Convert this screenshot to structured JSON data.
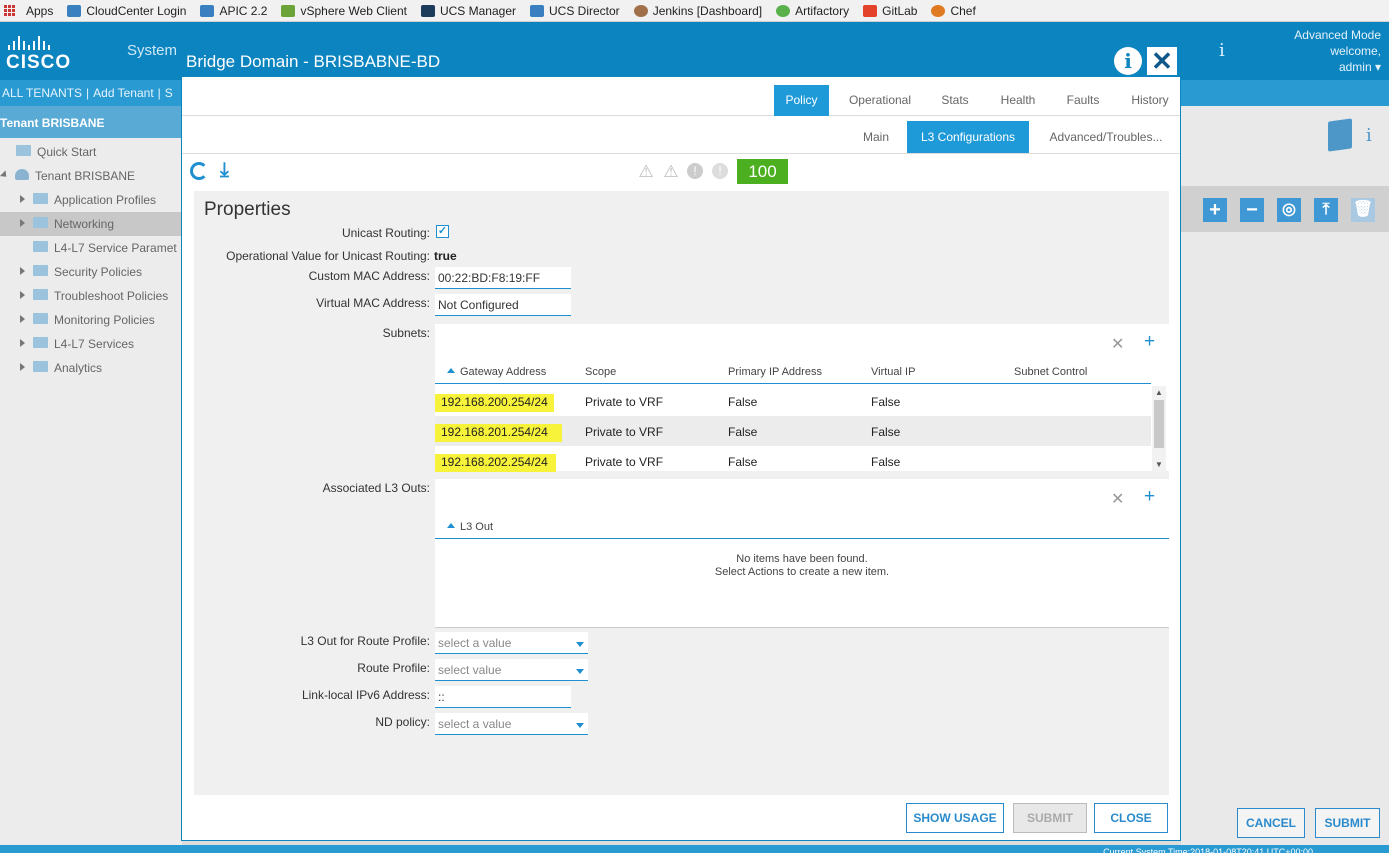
{
  "bookmarks": [
    {
      "label": "Apps",
      "color": "#cc3333"
    },
    {
      "label": "CloudCenter Login",
      "color": "#3a7fc0"
    },
    {
      "label": "APIC 2.2",
      "color": "#3a7fc0"
    },
    {
      "label": "vSphere Web Client",
      "color": "#6ca33a"
    },
    {
      "label": "UCS Manager",
      "color": "#1d3c5c"
    },
    {
      "label": "UCS Director",
      "color": "#3a7fc0"
    },
    {
      "label": "Jenkins [Dashboard]",
      "color": "#a0704a"
    },
    {
      "label": "Artifactory",
      "color": "#5ab04a"
    },
    {
      "label": "GitLab",
      "color": "#e2432a"
    },
    {
      "label": "Chef",
      "color": "#e07a22"
    }
  ],
  "header": {
    "logo_text": "CISCO",
    "nav_system": "System",
    "mode": "Advanced Mode",
    "welcome": "welcome,",
    "user": "admin ▾",
    "info_glyph": "i"
  },
  "subnav": {
    "all_tenants": "ALL TENANTS",
    "sep": "|",
    "add_tenant": "Add Tenant",
    "sep2": "|",
    "more": "S"
  },
  "sidebar": {
    "tenant_head": "Tenant BRISBANE",
    "items": [
      {
        "label": "Quick Start"
      },
      {
        "label": "Tenant BRISBANE"
      },
      {
        "label": "Application Profiles"
      },
      {
        "label": "Networking"
      },
      {
        "label": "L4-L7 Service Paramet"
      },
      {
        "label": "Security Policies"
      },
      {
        "label": "Troubleshoot Policies"
      },
      {
        "label": "Monitoring Policies"
      },
      {
        "label": "L4-L7 Services"
      },
      {
        "label": "Analytics"
      }
    ]
  },
  "background": {
    "cancel": "CANCEL",
    "submit": "SUBMIT",
    "status": "Current System Time:2018-01-08T20:41 UTC+00:00",
    "info_glyph": "i"
  },
  "modal": {
    "title": "Bridge Domain - BRISBABNE-BD",
    "info_glyph": "i",
    "close_glyph": "✕",
    "tabs": [
      {
        "label": "Policy"
      },
      {
        "label": "Operational"
      },
      {
        "label": "Stats"
      },
      {
        "label": "Health"
      },
      {
        "label": "Faults"
      },
      {
        "label": "History"
      }
    ],
    "subtabs": [
      {
        "label": "Main"
      },
      {
        "label": "L3 Configurations"
      },
      {
        "label": "Advanced/Troubles..."
      }
    ],
    "health_score": "100",
    "fault_glyph": "⚠",
    "fault_glyph2": "!",
    "properties": {
      "title": "Properties",
      "unicast_routing_label": "Unicast Routing:",
      "check_glyph": "✓",
      "op_value_label": "Operational Value for Unicast Routing:",
      "op_value": "true",
      "custom_mac_label": "Custom MAC Address:",
      "custom_mac": "00:22:BD:F8:19:FF",
      "virtual_mac_label": "Virtual MAC Address:",
      "virtual_mac": "Not Configured",
      "subnets_label": "Subnets:",
      "subnets": {
        "columns": [
          "Gateway Address",
          "Scope",
          "Primary IP Address",
          "Virtual IP",
          "Subnet Control"
        ],
        "rows": [
          {
            "gateway": "192.168.200.254/24",
            "scope": "Private to VRF",
            "primary": "False",
            "virtual": "False",
            "control": ""
          },
          {
            "gateway": "192.168.201.254/24",
            "scope": "Private to VRF",
            "primary": "False",
            "virtual": "False",
            "control": ""
          },
          {
            "gateway": "192.168.202.254/24",
            "scope": "Private to VRF",
            "primary": "False",
            "virtual": "False",
            "control": ""
          }
        ]
      },
      "assoc_l3_label": "Associated L3 Outs:",
      "l3out_column": "L3 Out",
      "empty_line1": "No items have been found.",
      "empty_line2": "Select Actions to create a new item.",
      "route_profile_l3out_label": "L3 Out for Route Profile:",
      "route_profile_l3out": "select a value",
      "route_profile_label": "Route Profile:",
      "route_profile": "select value",
      "linklocal_label": "Link-local IPv6 Address:",
      "linklocal": "::",
      "nd_policy_label": "ND policy:",
      "nd_policy": "select a value"
    },
    "buttons": {
      "show_usage": "SHOW USAGE",
      "submit": "SUBMIT",
      "close": "CLOSE"
    }
  },
  "actions": {
    "delete_glyph": "✕",
    "add_glyph": "+"
  }
}
